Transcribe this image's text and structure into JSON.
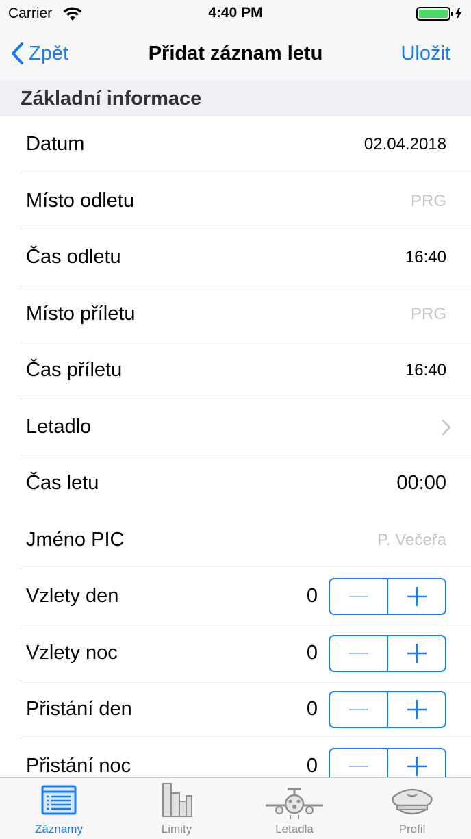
{
  "status_bar": {
    "carrier": "Carrier",
    "time": "4:40 PM"
  },
  "nav": {
    "back_label": "Zpět",
    "title": "Přidat záznam letu",
    "save_label": "Uložit"
  },
  "section": {
    "title": "Základní informace"
  },
  "rows": {
    "datum": {
      "label": "Datum",
      "value": "02.04.2018"
    },
    "misto_odletu": {
      "label": "Místo odletu",
      "placeholder": "PRG"
    },
    "cas_odletu": {
      "label": "Čas odletu",
      "value": "16:40"
    },
    "misto_priletu": {
      "label": "Místo příletu",
      "placeholder": "PRG"
    },
    "cas_priletu": {
      "label": "Čas příletu",
      "value": "16:40"
    },
    "letadlo": {
      "label": "Letadlo"
    },
    "cas_letu": {
      "label": "Čas letu",
      "value": "00:00"
    },
    "jmeno_pic": {
      "label": "Jméno PIC",
      "placeholder": "P. Večeřa"
    },
    "vzlety_den": {
      "label": "Vzlety den",
      "count": "0"
    },
    "vzlety_noc": {
      "label": "Vzlety noc",
      "count": "0"
    },
    "pristani_den": {
      "label": "Přistání den",
      "count": "0"
    },
    "pristani_noc": {
      "label": "Přistání noc",
      "count": "0"
    }
  },
  "tabs": [
    {
      "label": "Záznamy",
      "icon": "records-list-icon",
      "active": true
    },
    {
      "label": "Limity",
      "icon": "bar-chart-icon",
      "active": false
    },
    {
      "label": "Letadla",
      "icon": "airplane-icon",
      "active": false
    },
    {
      "label": "Profil",
      "icon": "pilot-cap-icon",
      "active": false
    }
  ],
  "colors": {
    "accent": "#1a7cf5",
    "placeholder": "#c4c4c8",
    "separator": "#d8d8dc",
    "section_bg": "#efeff4",
    "battery": "#4cd964"
  }
}
